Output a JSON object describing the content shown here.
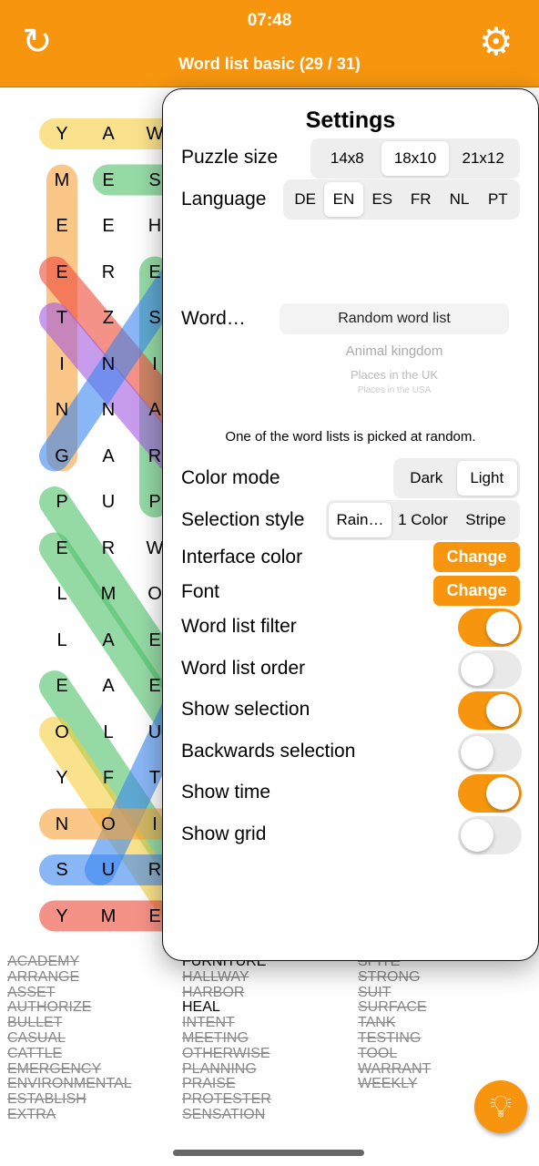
{
  "header": {
    "time": "07:48",
    "title": "Word list basic (29 / 31)",
    "restart_icon": "refresh-icon",
    "settings_icon": "gear-icon",
    "color": "#f7960e"
  },
  "grid": {
    "columns": [
      [
        "Y",
        "M",
        "E",
        "E",
        "T",
        "I",
        "N",
        "G",
        "P",
        "E",
        "L",
        "L",
        "E",
        "O",
        "Y",
        "N",
        "S",
        "Y"
      ],
      [
        "A",
        "E",
        "E",
        "R",
        "Z",
        "N",
        "N",
        "A",
        "U",
        "R",
        "M",
        "A",
        "A",
        "L",
        "F",
        "O",
        "U",
        "M"
      ],
      [
        "W",
        "S",
        "H",
        "E",
        "S",
        "I",
        "A",
        "R",
        "P",
        "W",
        "O",
        "E",
        "E",
        "U",
        "T",
        "I",
        "R",
        "E"
      ]
    ]
  },
  "word_list": {
    "columns": [
      [
        {
          "w": "ACADEMY",
          "found": true
        },
        {
          "w": "ARRANGE",
          "found": true
        },
        {
          "w": "ASSET",
          "found": true
        },
        {
          "w": "AUTHORIZE",
          "found": true
        },
        {
          "w": "BULLET",
          "found": true
        },
        {
          "w": "CASUAL",
          "found": true
        },
        {
          "w": "CATTLE",
          "found": true
        },
        {
          "w": "EMERGENCY",
          "found": true
        },
        {
          "w": "ENVIRONMENTAL",
          "found": true
        },
        {
          "w": "ESTABLISH",
          "found": true
        },
        {
          "w": "EXTRA",
          "found": true
        }
      ],
      [
        {
          "w": "FURNITURE",
          "found": false
        },
        {
          "w": "HALLWAY",
          "found": true
        },
        {
          "w": "HARBOR",
          "found": true
        },
        {
          "w": "HEAL",
          "found": false
        },
        {
          "w": "INTENT",
          "found": true
        },
        {
          "w": "MEETING",
          "found": true
        },
        {
          "w": "OTHERWISE",
          "found": true
        },
        {
          "w": "PLANNING",
          "found": true
        },
        {
          "w": "PRAISE",
          "found": true
        },
        {
          "w": "PROTESTER",
          "found": true
        },
        {
          "w": "SENSATION",
          "found": true
        }
      ],
      [
        {
          "w": "SPITE",
          "found": true
        },
        {
          "w": "STRONG",
          "found": true
        },
        {
          "w": "SUIT",
          "found": true
        },
        {
          "w": "SURFACE",
          "found": true
        },
        {
          "w": "TANK",
          "found": true
        },
        {
          "w": "TESTING",
          "found": true
        },
        {
          "w": "TOOL",
          "found": true
        },
        {
          "w": "WARRANT",
          "found": true
        },
        {
          "w": "WEEKLY",
          "found": true
        }
      ]
    ]
  },
  "settings": {
    "title": "Settings",
    "puzzle_size": {
      "label": "Puzzle size",
      "options": [
        "14x8",
        "18x10",
        "21x12"
      ],
      "selected": "18x10"
    },
    "language": {
      "label": "Language",
      "options": [
        "DE",
        "EN",
        "ES",
        "FR",
        "NL",
        "PT"
      ],
      "selected": "EN"
    },
    "word": {
      "label": "Word…",
      "selected": "Random word list",
      "options": [
        "Animal kingdom",
        "Places in the UK",
        "Places in the USA"
      ]
    },
    "note": "One of the word lists is picked at random.",
    "color_mode": {
      "label": "Color mode",
      "options": [
        "Dark",
        "Light"
      ],
      "selected": "Light"
    },
    "selection_style": {
      "label": "Selection style",
      "options": [
        "Rain…",
        "1 Color",
        "Stripe"
      ],
      "selected": "Rain…"
    },
    "interface_color": {
      "label": "Interface color",
      "button": "Change"
    },
    "font": {
      "label": "Font",
      "button": "Change"
    },
    "toggles": [
      {
        "label": "Word list filter",
        "on": true
      },
      {
        "label": "Word list order",
        "on": false
      },
      {
        "label": "Show selection",
        "on": true
      },
      {
        "label": "Backwards selection",
        "on": false
      },
      {
        "label": "Show time",
        "on": true
      },
      {
        "label": "Show grid",
        "on": false
      }
    ]
  },
  "hint_icon": "lightbulb-icon"
}
